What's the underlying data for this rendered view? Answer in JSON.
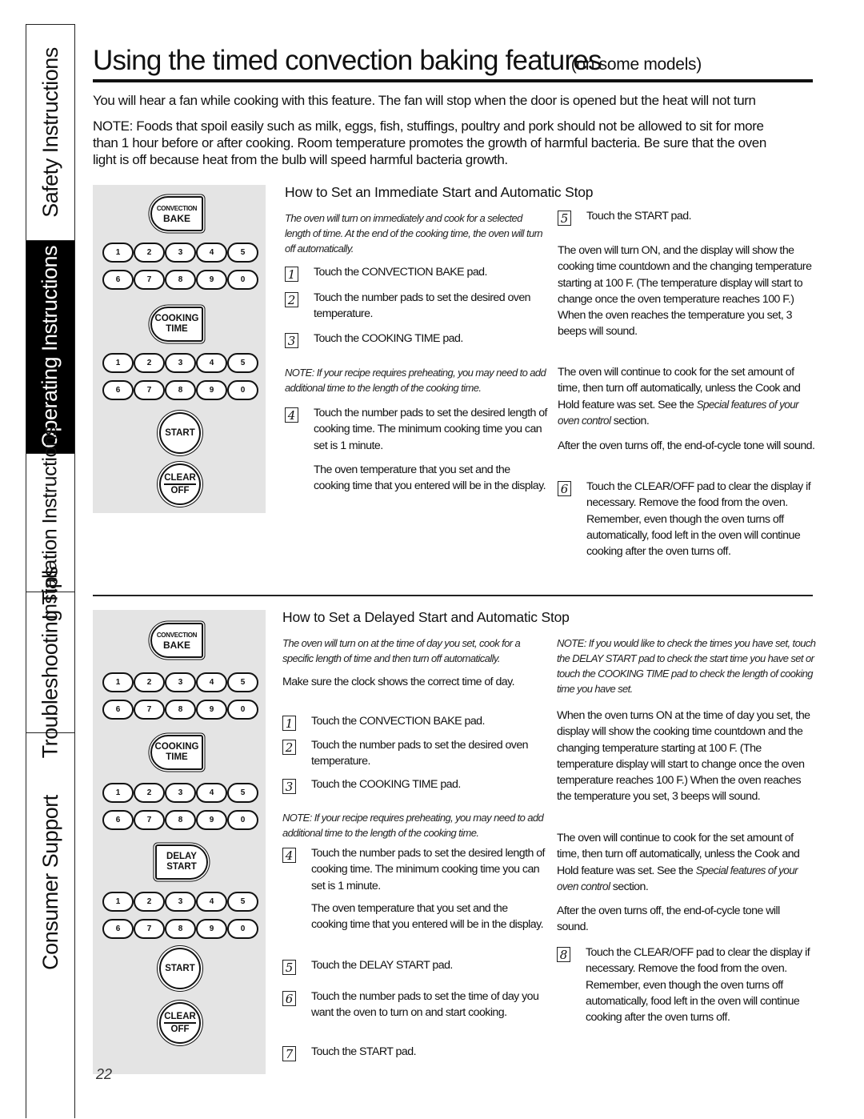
{
  "side_tabs": [
    {
      "label": "Safety Instructions",
      "active": false
    },
    {
      "label": "Operating Instructions",
      "active": true
    },
    {
      "label": "Installation Instructions",
      "active": false
    },
    {
      "label": "Troubleshooting Tips",
      "active": false
    },
    {
      "label": "Consumer Support",
      "active": false
    }
  ],
  "header": {
    "title": "Using the timed convection baking features",
    "subtitle": "(on some models)"
  },
  "intro": "You will hear a fan while cooking with this feature. The fan will stop when the door is opened but the heat will not turn",
  "note_top": "NOTE: Foods that spoil easily such as milk, eggs, fish, stuffings, poultry and pork should not be allowed to sit for more\nthan 1 hour before or after cooking. Room temperature promotes the growth of harmful bacteria. Be sure that the oven\nlight is off because heat from the bulb will speed harmful bacteria growth.",
  "keypad": {
    "convection_bake": {
      "line1": "CONVECTION",
      "line2": "BAKE"
    },
    "cooking_time": {
      "line1": "COOKING",
      "line2": "TIME"
    },
    "delay_start": {
      "line1": "DELAY",
      "line2": "START"
    },
    "start": "START",
    "clear_off": {
      "line1": "CLEAR",
      "line2": "OFF"
    },
    "digits_row1": [
      "1",
      "2",
      "3",
      "4",
      "5"
    ],
    "digits_row2": [
      "6",
      "7",
      "8",
      "9",
      "0"
    ]
  },
  "section1": {
    "heading": "How to Set an Immediate Start and Automatic Stop",
    "intro": "The oven will turn on immediately and cook for a selected length of time. At the end of the cooking time, the oven will turn off automatically.",
    "steps": [
      {
        "num": "1",
        "text": "Touch the CONVECTION BAKE pad."
      },
      {
        "num": "2",
        "text": "Touch the number pads to set the desired oven temperature."
      },
      {
        "num": "3",
        "text": "Touch the COOKING TIME pad."
      },
      {
        "num": "4",
        "text": "Touch the number pads to set the desired length of cooking time. The minimum cooking time you can set is 1 minute."
      },
      {
        "num": "5",
        "text": "Touch the START pad."
      },
      {
        "num": "6",
        "text": "Touch the CLEAR/OFF pad to clear the display if necessary. Remove the food from the oven. Remember, even though the oven turns off automatically, food left in the oven will continue cooking after the oven turns off."
      }
    ],
    "note": "NOTE: If your recipe requires preheating, you may need to add additional time to the length of the cooking time.",
    "step4_followup": "The oven temperature that you set and the cooking time that you entered will be in the display.",
    "after_start": "The oven will turn ON, and the display will show the cooking time countdown and the changing temperature starting at 100 F. (The temperature display will start to change once the oven temperature reaches 100 F.) When the oven reaches the temperature you set, 3 beeps will sound.",
    "continue_text": "The oven will continue to cook for the set amount of time, then turn off automatically, unless the Cook and Hold feature was set. See the",
    "continue_ref": "Special features of your oven control",
    "continue_tail": "section.",
    "end_tone": "After the oven turns off, the end-of-cycle tone will sound."
  },
  "section2": {
    "heading": "How to Set a Delayed Start and Automatic Stop",
    "intro": "The oven will turn on at the time of day you set, cook for a specific length of time and then turn off automatically.",
    "clock_note": "Make sure the clock shows the correct time of day.",
    "steps": [
      {
        "num": "1",
        "text": "Touch the CONVECTION BAKE pad."
      },
      {
        "num": "2",
        "text": "Touch the number pads to set the desired oven temperature."
      },
      {
        "num": "3",
        "text": "Touch the COOKING TIME pad."
      },
      {
        "num": "4",
        "text": "Touch the number pads to set the desired length of cooking time. The minimum cooking time you can set is 1 minute."
      },
      {
        "num": "5",
        "text": "Touch the DELAY START pad."
      },
      {
        "num": "6",
        "text": "Touch the number pads to set the time of day you want the oven to turn on and start cooking."
      },
      {
        "num": "7",
        "text": "Touch the START pad."
      },
      {
        "num": "8",
        "text": "Touch the CLEAR/OFF pad to clear the display if necessary. Remove the food from the oven. Remember, even though the oven turns off automatically, food left in the oven will continue cooking after the oven turns off."
      }
    ],
    "note": "NOTE: If your recipe requires preheating, you may need to add additional time to the length of the cooking time.",
    "step4_followup": "The oven temperature that you set and the cooking time that you entered will be in the display.",
    "check_note": "NOTE: If you would like to check the times you have set, touch the DELAY START pad to check the start time you have set or touch the COOKING TIME pad to check the length of cooking time you have set.",
    "after_on": "When the oven turns ON at the time of day you set, the display will show the cooking time countdown and the changing temperature starting at 100 F. (The temperature display will start to change once the oven temperature reaches 100 F.) When the oven reaches the temperature you set, 3 beeps will sound.",
    "continue_text": "The oven will continue to cook for the set amount of time, then turn off automatically, unless the Cook and Hold feature was set. See the",
    "continue_ref": "Special features of your oven control",
    "continue_tail": "section.",
    "end_tone": "After the oven turns off, the end-of-cycle tone will sound."
  },
  "page_number": "22"
}
